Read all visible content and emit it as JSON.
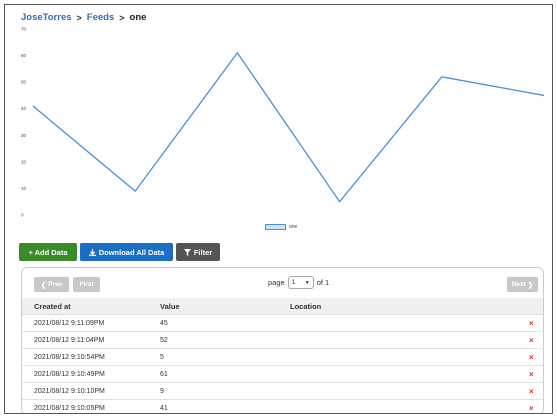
{
  "breadcrumb": {
    "user": "JoseTorres",
    "feeds": "Feeds",
    "current": "one",
    "separator": ">"
  },
  "chart_data": {
    "type": "line",
    "series": [
      {
        "name": "one",
        "values": [
          41,
          9,
          61,
          5,
          52,
          45
        ],
        "color": "#4a90d9"
      }
    ],
    "ylim": [
      0,
      70
    ],
    "yticks": [
      0,
      10,
      20,
      30,
      40,
      50,
      60,
      70
    ],
    "title": "",
    "xlabel": "",
    "ylabel": "",
    "legend": "bottom-center",
    "grid": false
  },
  "toolbar": {
    "add_label": "+ Add Data",
    "download_label": "Download All Data",
    "filter_label": "Filter"
  },
  "pager": {
    "prev_label": "Prev",
    "first_label": "First",
    "next_label": "Next",
    "page_label": "page",
    "page_value": "1",
    "of_label": "of 1"
  },
  "table": {
    "headers": {
      "created": "Created at",
      "value": "Value",
      "location": "Location"
    },
    "rows": [
      {
        "created": "2021/08/12 9:11:09PM",
        "value": "45",
        "location": ""
      },
      {
        "created": "2021/08/12 9:11:04PM",
        "value": "52",
        "location": ""
      },
      {
        "created": "2021/08/12 9:10:54PM",
        "value": "5",
        "location": ""
      },
      {
        "created": "2021/08/12 9:10:49PM",
        "value": "61",
        "location": ""
      },
      {
        "created": "2021/08/12 9:10:10PM",
        "value": "9",
        "location": ""
      },
      {
        "created": "2021/08/12 9:10:05PM",
        "value": "41",
        "location": ""
      }
    ],
    "delete_icon": "×",
    "delete_color": "#d9342b"
  },
  "colors": {
    "link": "#2f6fb3",
    "add": "#3a8a2a",
    "download": "#1a6fc4",
    "filter": "#555555"
  }
}
